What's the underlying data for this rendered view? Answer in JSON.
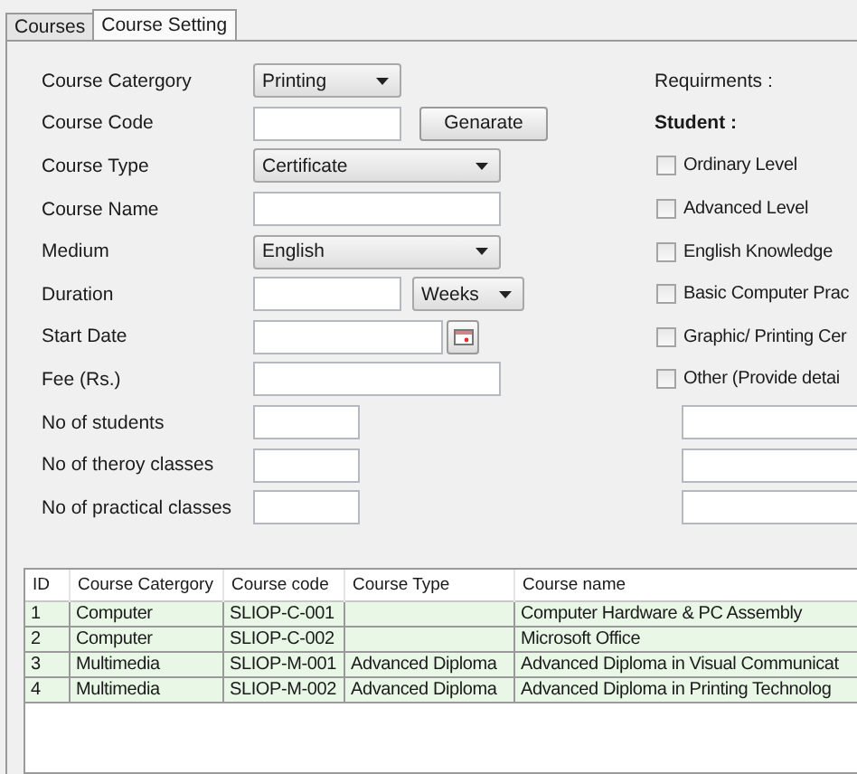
{
  "tabs": [
    {
      "label": "Courses",
      "selected": false
    },
    {
      "label": "Course Setting",
      "selected": true
    }
  ],
  "form": [
    {
      "label": "Course Catergory",
      "controls": [
        {
          "kind": "shortselect",
          "value": "Printing"
        }
      ]
    },
    {
      "label": "Course Code",
      "controls": [
        {
          "kind": "shortfield"
        },
        {
          "kind": "button",
          "value": "Genarate"
        }
      ]
    },
    {
      "label": "Course Type",
      "controls": [
        {
          "kind": "select",
          "value": "Certificate"
        }
      ]
    },
    {
      "label": "Course Name",
      "controls": [
        {
          "kind": "field"
        }
      ]
    },
    {
      "label": "Medium",
      "controls": [
        {
          "kind": "select",
          "value": "English"
        }
      ]
    },
    {
      "label": "Duration",
      "controls": [
        {
          "kind": "shortfield"
        },
        {
          "kind": "unitselect",
          "value": "Weeks"
        }
      ]
    },
    {
      "label": "Start Date",
      "controls": [
        {
          "kind": "datefield"
        }
      ]
    },
    {
      "label": "Fee (Rs.)",
      "controls": [
        {
          "kind": "field"
        }
      ]
    },
    {
      "label": "No of students",
      "controls": [
        {
          "kind": "countfield"
        }
      ]
    },
    {
      "label": "No of theroy classes",
      "controls": [
        {
          "kind": "countfield"
        }
      ]
    },
    {
      "label": "No of practical classes",
      "controls": [
        {
          "kind": "countfield"
        }
      ]
    }
  ],
  "requirements": {
    "title": "Requirments :",
    "subtitle": "Student :",
    "options": [
      {
        "label": "Ordinary Level",
        "checked": false
      },
      {
        "label": "Advanced Level",
        "checked": false
      },
      {
        "label": "English Knowledge",
        "checked": false
      },
      {
        "label": "Basic Computer Prac",
        "checked": false
      },
      {
        "label": "Graphic/ Printing Cer",
        "checked": false
      },
      {
        "label": "Other (Provide detai",
        "checked": false
      }
    ],
    "details": [
      {
        "kind": "field"
      },
      {
        "kind": "field"
      },
      {
        "kind": "field"
      }
    ]
  },
  "table": {
    "columns": [
      "ID",
      "Course Catergory",
      "Course code",
      "Course Type",
      "Course name"
    ],
    "rows": [
      [
        "1",
        "Computer",
        "SLIOP-C-001",
        "",
        "Computer Hardware & PC Assembly"
      ],
      [
        "2",
        "Computer",
        "SLIOP-C-002",
        "",
        "Microsoft Office"
      ],
      [
        "3",
        "Multimedia",
        "SLIOP-M-001",
        "Advanced Diploma",
        "Advanced Diploma in Visual Communicat"
      ],
      [
        "4",
        "Multimedia",
        "SLIOP-M-002",
        "Advanced Diploma",
        "Advanced Diploma in Printing Technolog"
      ]
    ]
  }
}
